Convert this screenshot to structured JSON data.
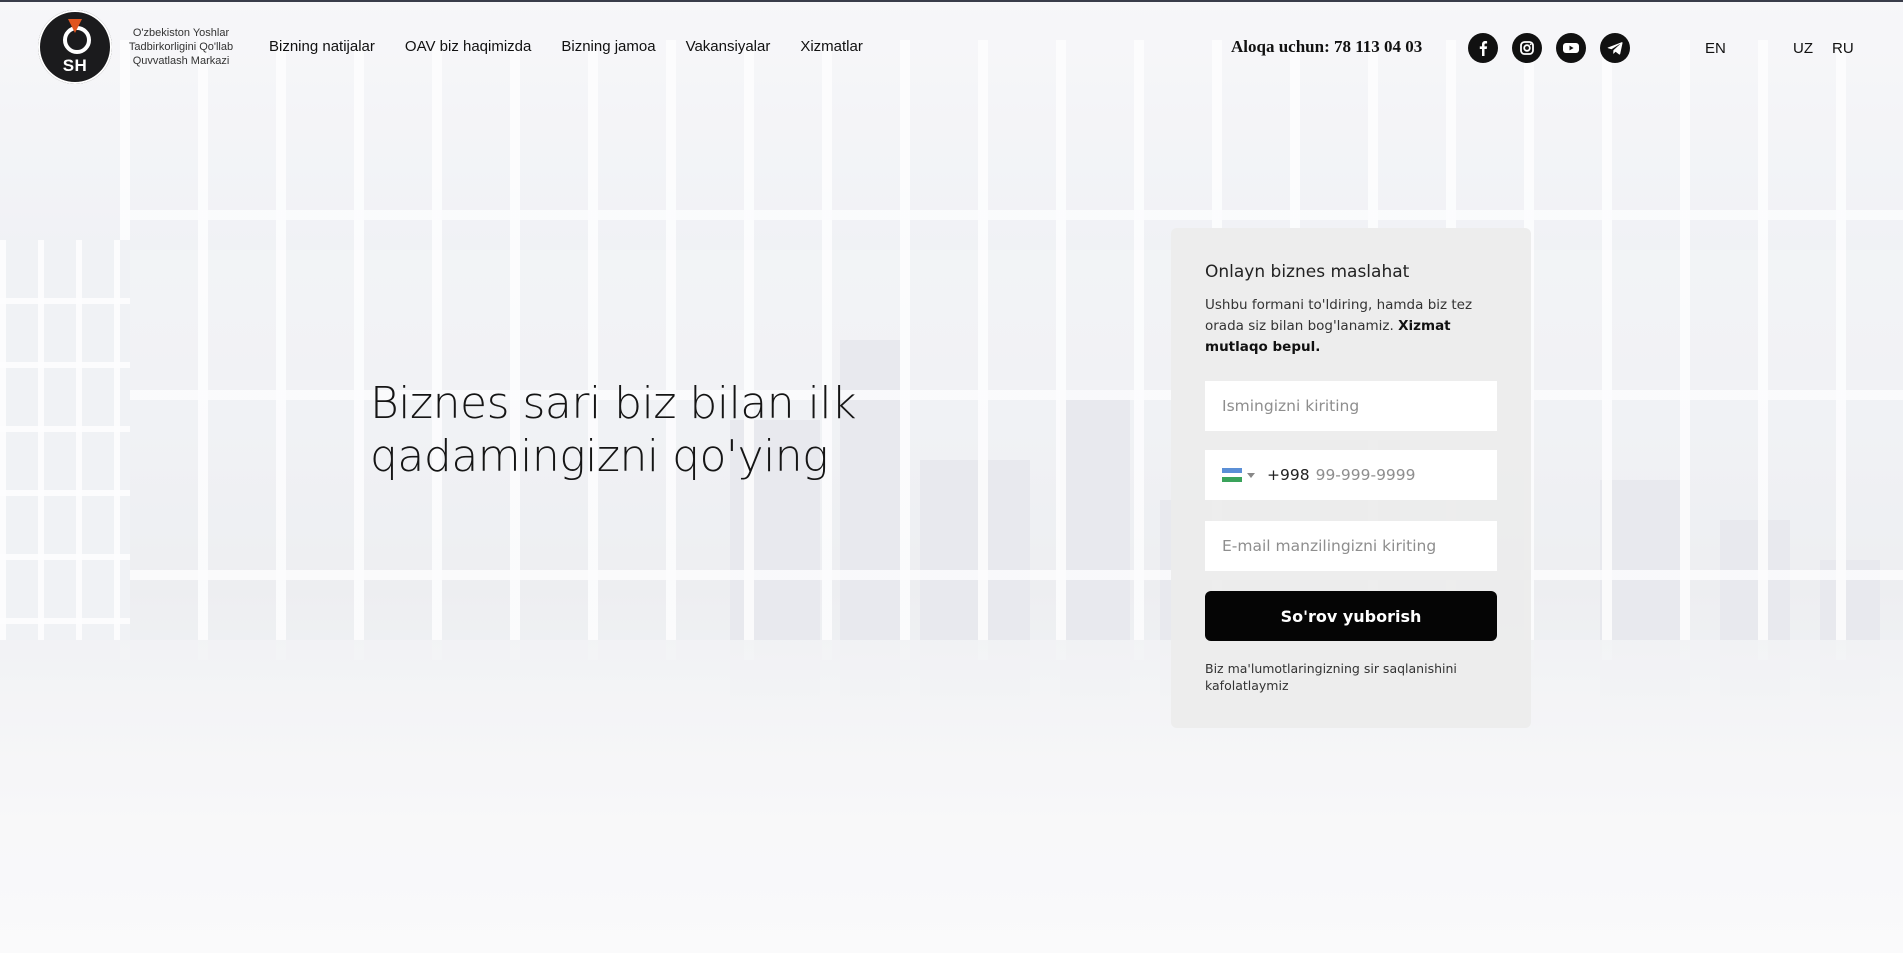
{
  "header": {
    "logo": {
      "mark": "SH",
      "lines": [
        "O'zbekiston Yoshlar",
        "Tadbirkorligini Qo'llab",
        "Quvvatlash Markazi"
      ]
    },
    "nav": [
      {
        "label": "Bizning natijalar"
      },
      {
        "label": "OAV biz haqimizda"
      },
      {
        "label": "Bizning jamoa"
      },
      {
        "label": "Vakansiyalar"
      },
      {
        "label": "Xizmatlar"
      }
    ],
    "contact": "Aloqa uchun: 78 113 04 03",
    "socials": [
      "facebook-icon",
      "instagram-icon",
      "youtube-icon",
      "telegram-icon"
    ],
    "languages": [
      "EN",
      "UZ",
      "RU"
    ]
  },
  "hero": {
    "title_line1": "Biznes sari biz bilan ilk",
    "title_line2": "qadamingizni qo'ying"
  },
  "form": {
    "title": "Onlayn biznes maslahat",
    "description": "Ushbu formani to'ldiring, hamda biz tez orada siz bilan bog'lanamiz.",
    "description_bold": "Xizmat mutlaqo bepul.",
    "name_placeholder": "Ismingizni kiriting",
    "phone_code": "+998",
    "phone_placeholder": "99-999-9999",
    "email_placeholder": "E-mail manzilingizni kiriting",
    "submit_label": "So'rov yuborish",
    "note": "Biz ma'lumotlaringizning sir saqlanishini kafolatlaymiz",
    "flag_colors": [
      "#5b8fd6",
      "#ffffff",
      "#3aa35b"
    ]
  },
  "colors": {
    "button": "#050505",
    "logo_accent": "#e0541e",
    "card": "#ececec"
  }
}
